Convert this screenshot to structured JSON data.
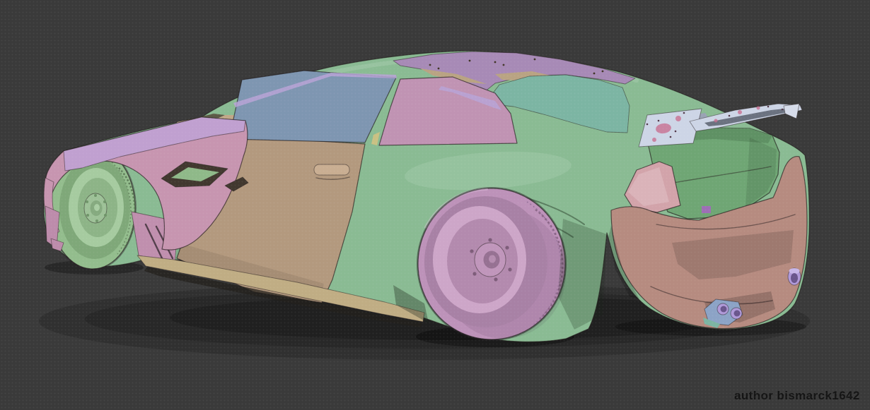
{
  "scene": {
    "credit": "author bismarck1642"
  },
  "palette": {
    "background": "#3a3a3a",
    "body_green": "#8abb93",
    "roof_purple": "#a78ab6",
    "roof_tan": "#b9a383",
    "teal_panel": "#7cb5a3",
    "window_blue": "#7e96b1",
    "window_pink": "#c093b3",
    "trim_lavender": "#b7a3d6",
    "door_tan": "#b3997e",
    "handle_tan": "#c9ae92",
    "mirror_tan": "#bea287",
    "cowl_tan": "#c0a888",
    "cowl_dark": "#5c5a46",
    "fender_pink": "#c795b0",
    "fender_purple": "#c0a0d0",
    "panel_pink": "#c08fae",
    "canard_pink": "#bd8cab",
    "vent_dark": "#41382f",
    "vent_green": "#8fb989",
    "wheel_green_tire": "#93bd8d",
    "wheel_green_barrel": "#7fa879",
    "wheel_green_face": "#a6cba0",
    "wheel_green_hub": "#9dc197",
    "wheel_pink_tire": "#bd92b9",
    "wheel_pink_barrel": "#a881a5",
    "wheel_pink_face": "#cda6c8",
    "wheel_pink_hub": "#c096bb",
    "skirt_khaki": "#c0ad84",
    "trunk_green": "#6fa674",
    "trunk_green_dark": "#5f9164",
    "badge_purple": "#9d6fb5",
    "taillight_pink": "#d2a3aa",
    "bumper_rosy": "#b68b80",
    "wing_silver": "#cdd5e6",
    "wing_tip": "#d6dcea",
    "wing_slot": "#6b7280",
    "decal_pink": "#c8698c",
    "exhaust_blue": "#8ca3c6",
    "exhaust_purple": "#b09ad9",
    "exhaust_bore": "#6a568c",
    "pillar_accent": "#c9c183",
    "text": "#141414"
  }
}
